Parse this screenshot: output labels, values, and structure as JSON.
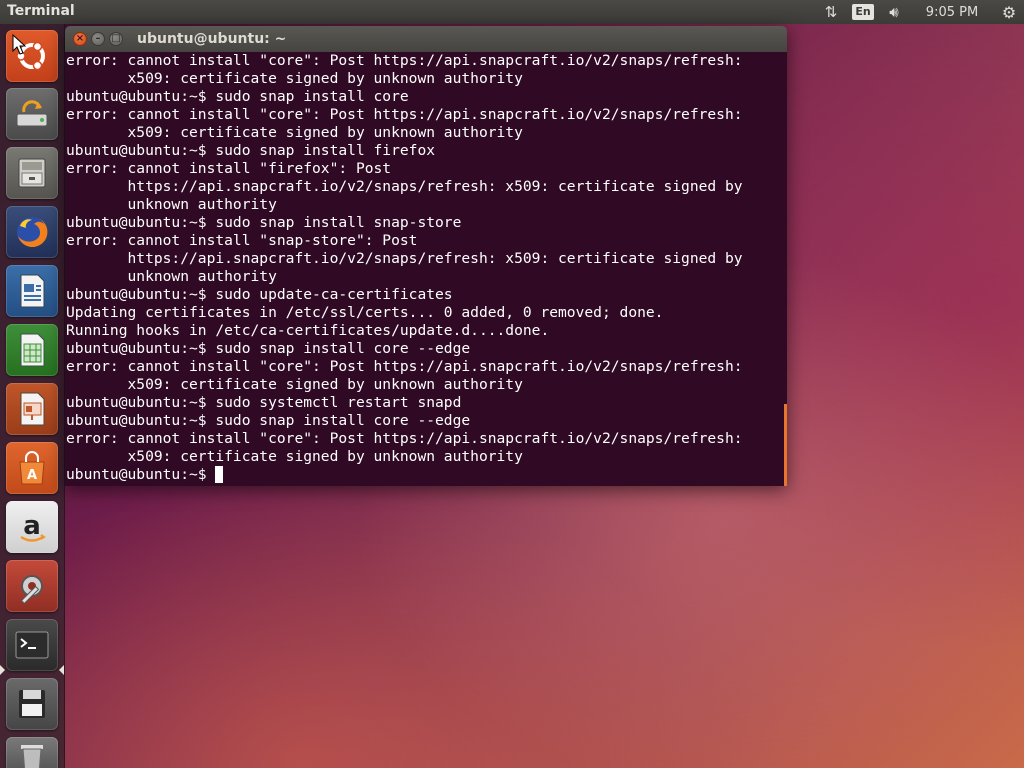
{
  "top_panel": {
    "app_title": "Terminal",
    "keyboard_layout": "En",
    "clock": "9:05 PM",
    "icons": {
      "network": "network-updown-icon",
      "volume": "volume-icon",
      "session": "gear-icon"
    }
  },
  "launcher": {
    "items": [
      {
        "name": "dash-home",
        "icon": "ubuntu-logo-icon"
      },
      {
        "name": "backup",
        "icon": "backup-drive-icon"
      },
      {
        "name": "files",
        "icon": "file-cabinet-icon"
      },
      {
        "name": "firefox",
        "icon": "firefox-icon"
      },
      {
        "name": "libreoffice-writer",
        "icon": "writer-document-icon"
      },
      {
        "name": "libreoffice-calc",
        "icon": "calc-spreadsheet-icon"
      },
      {
        "name": "libreoffice-impress",
        "icon": "impress-presentation-icon"
      },
      {
        "name": "ubuntu-software",
        "icon": "software-bag-icon"
      },
      {
        "name": "amazon",
        "icon": "amazon-icon"
      },
      {
        "name": "system-settings",
        "icon": "settings-tools-icon"
      },
      {
        "name": "terminal",
        "icon": "terminal-prompt-icon",
        "active": true
      },
      {
        "name": "save",
        "icon": "floppy-disk-icon"
      },
      {
        "name": "trash",
        "icon": "trash-icon"
      }
    ]
  },
  "window": {
    "title": "ubuntu@ubuntu: ~",
    "close_glyph": "×",
    "minimize_glyph": "–",
    "maximize_glyph": "□"
  },
  "terminal": {
    "prompt": "ubuntu@ubuntu:~$ ",
    "lines": [
      "error: cannot install \"core\": Post https://api.snapcraft.io/v2/snaps/refresh:",
      "       x509: certificate signed by unknown authority",
      "ubuntu@ubuntu:~$ sudo snap install core",
      "error: cannot install \"core\": Post https://api.snapcraft.io/v2/snaps/refresh:",
      "       x509: certificate signed by unknown authority",
      "ubuntu@ubuntu:~$ sudo snap install firefox",
      "error: cannot install \"firefox\": Post",
      "       https://api.snapcraft.io/v2/snaps/refresh: x509: certificate signed by",
      "       unknown authority",
      "ubuntu@ubuntu:~$ sudo snap install snap-store",
      "error: cannot install \"snap-store\": Post",
      "       https://api.snapcraft.io/v2/snaps/refresh: x509: certificate signed by",
      "       unknown authority",
      "ubuntu@ubuntu:~$ sudo update-ca-certificates",
      "Updating certificates in /etc/ssl/certs... 0 added, 0 removed; done.",
      "Running hooks in /etc/ca-certificates/update.d....done.",
      "ubuntu@ubuntu:~$ sudo snap install core --edge",
      "error: cannot install \"core\": Post https://api.snapcraft.io/v2/snaps/refresh:",
      "       x509: certificate signed by unknown authority",
      "ubuntu@ubuntu:~$ sudo systemctl restart snapd",
      "ubuntu@ubuntu:~$ sudo snap install core --edge",
      "error: cannot install \"core\": Post https://api.snapcraft.io/v2/snaps/refresh:",
      "       x509: certificate signed by unknown authority"
    ],
    "colors": {
      "background": "#300a24",
      "text": "#ffffff",
      "scroll_indicator": "#e8752e"
    }
  },
  "colors": {
    "panel": "#3c3b37",
    "close_button": "#df4a16",
    "launcher_active_arrow": "#e6e3dd"
  }
}
